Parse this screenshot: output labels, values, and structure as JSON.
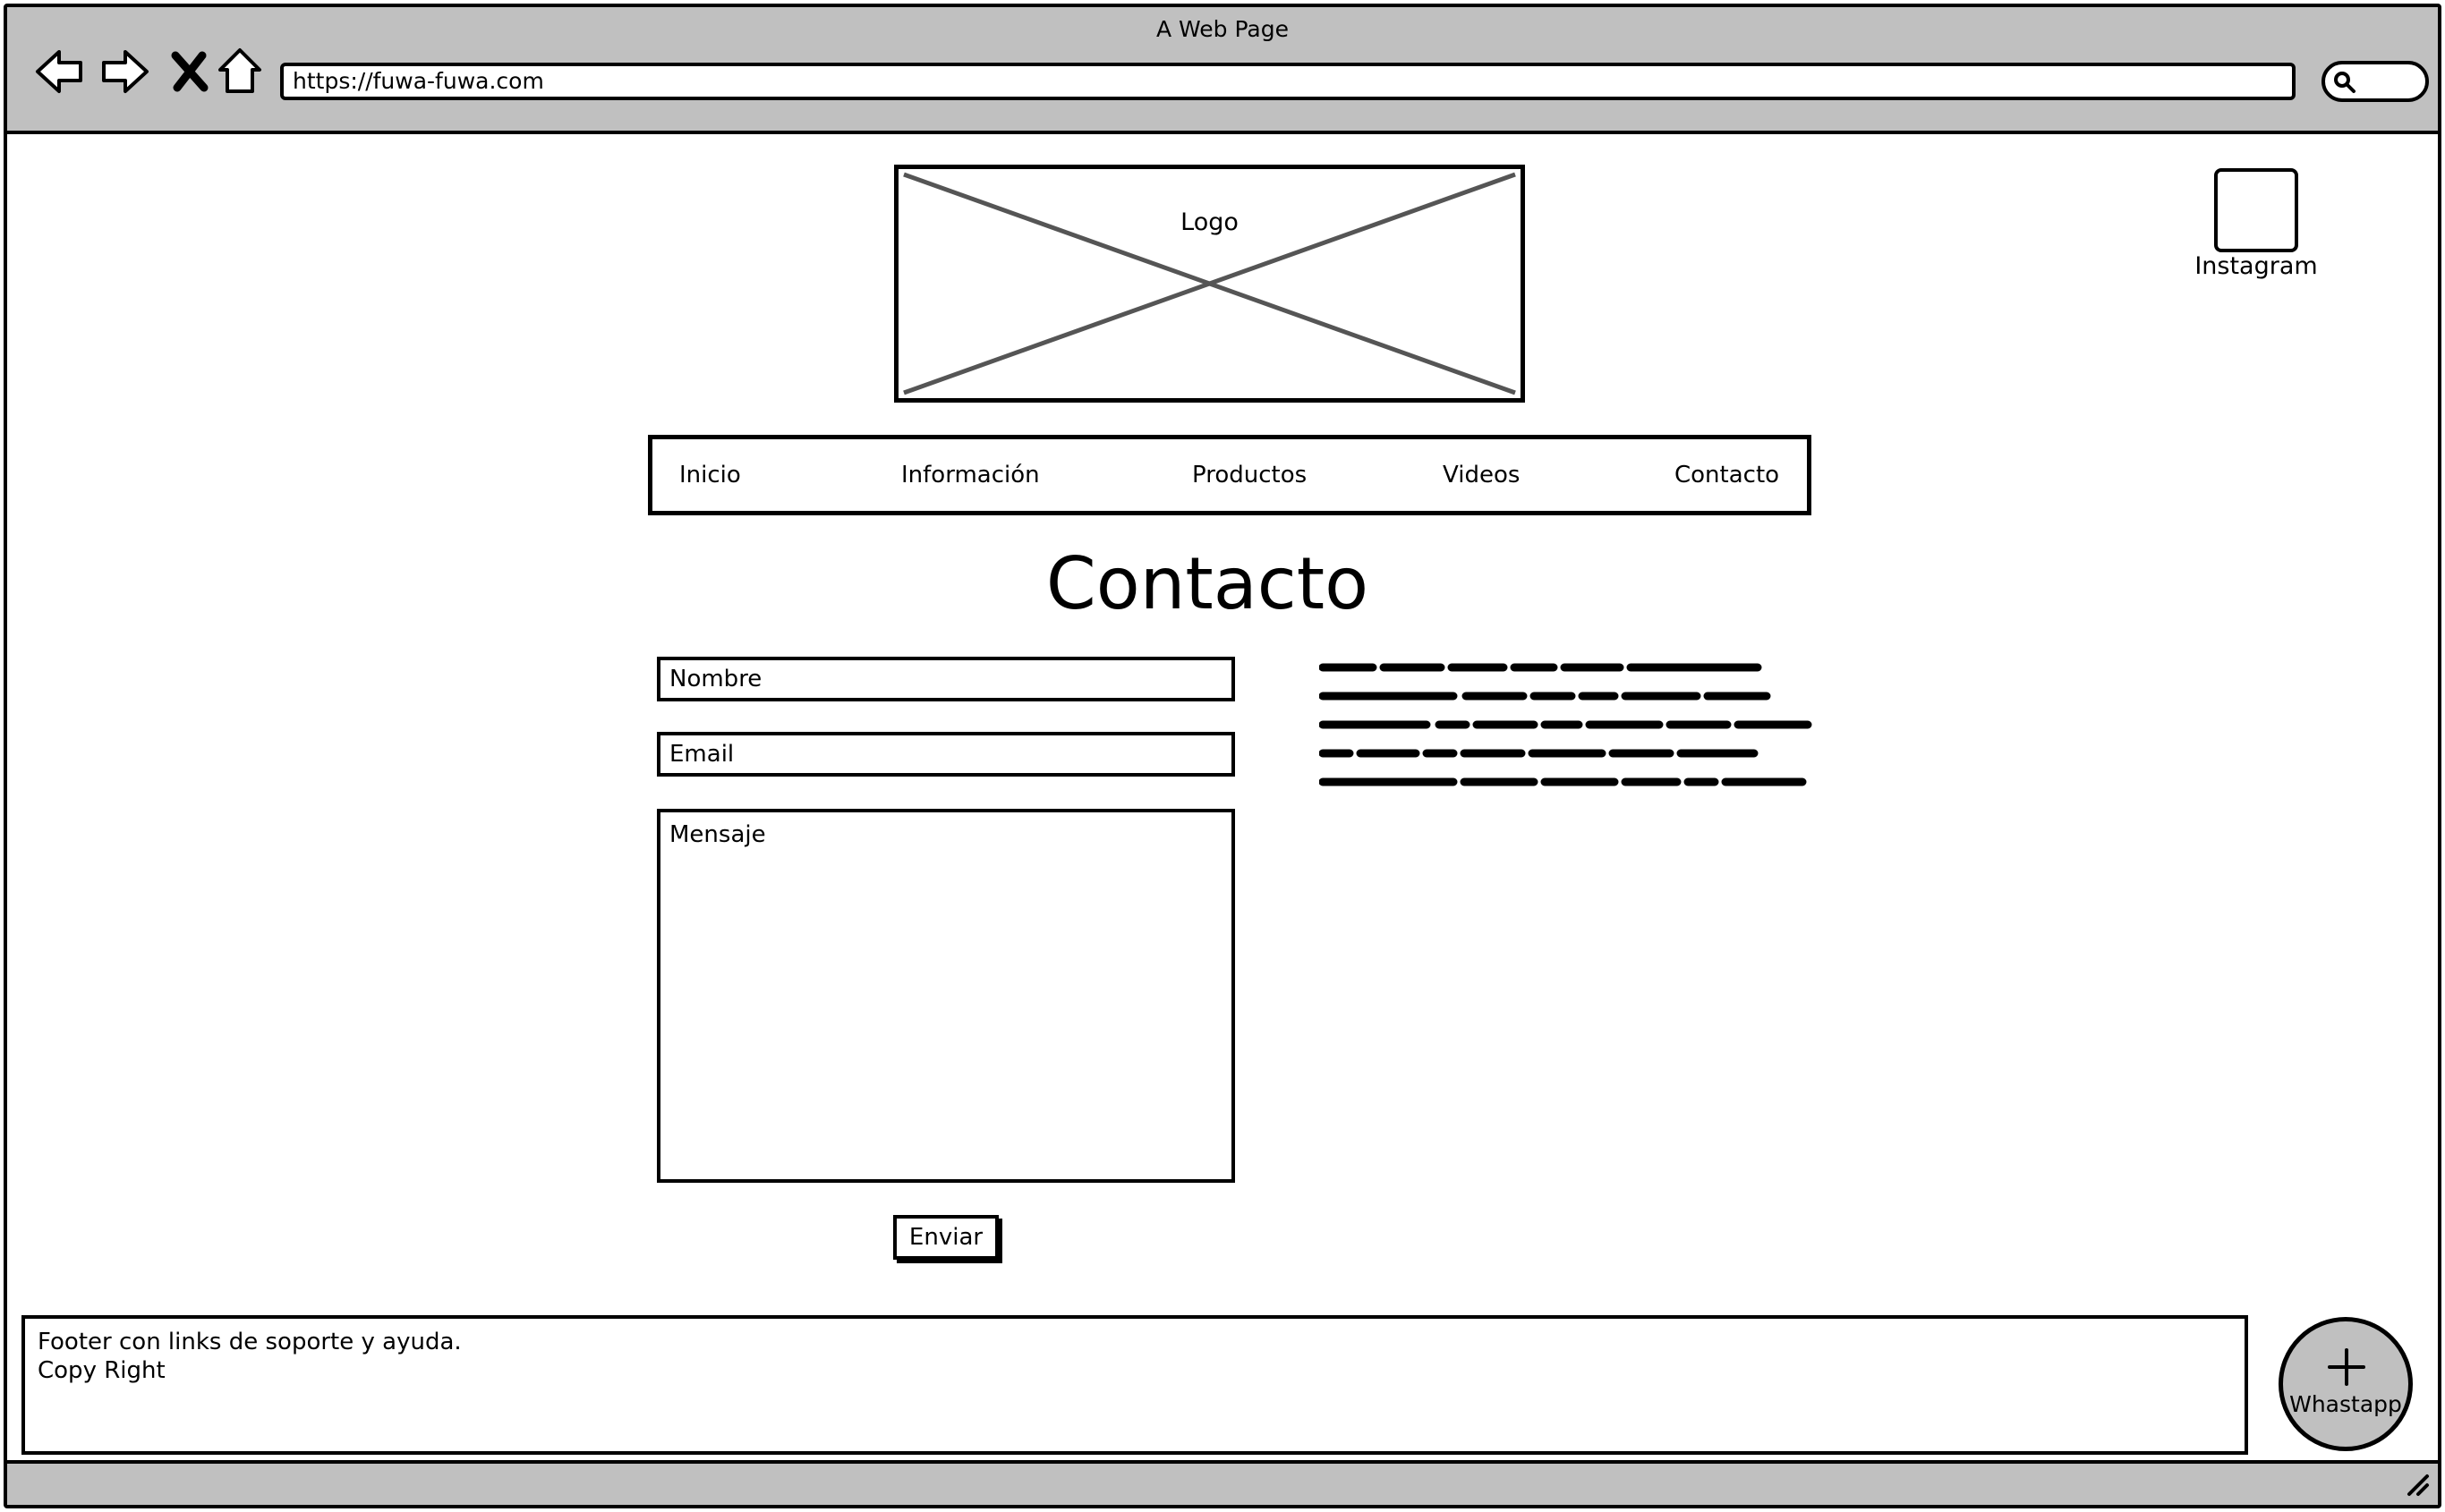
{
  "window": {
    "title": "A Web Page"
  },
  "toolbar": {
    "url": "https://fuwa-fuwa.com",
    "icons": [
      "back-arrow-icon",
      "forward-arrow-icon",
      "close-x-icon",
      "home-icon",
      "search-icon"
    ]
  },
  "header": {
    "logo_label": "Logo",
    "instagram_label": "Instagram"
  },
  "menu": {
    "items": [
      {
        "label": "Inicio"
      },
      {
        "label": "Información"
      },
      {
        "label": "Productos"
      },
      {
        "label": "Videos"
      },
      {
        "label": "Contacto"
      }
    ]
  },
  "contact": {
    "title": "Contacto",
    "name_placeholder": "Nombre",
    "email_placeholder": "Email",
    "message_placeholder": "Mensaje",
    "send_label": "Enviar"
  },
  "footer": {
    "line1": "Footer con links de soporte y ayuda.",
    "line2": "Copy Right"
  },
  "whatsapp": {
    "label": "Whastapp"
  },
  "colors": {
    "chrome_gray": "#c0c0c0",
    "ink": "#000000",
    "placeholder_x": "#555555"
  }
}
